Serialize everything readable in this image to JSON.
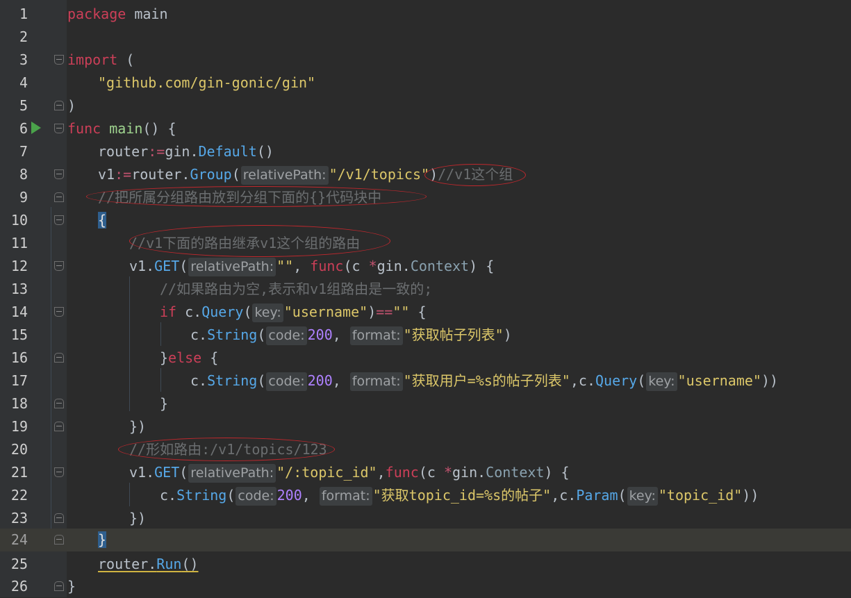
{
  "editor": {
    "language": "go",
    "current_line": 24,
    "colors": {
      "background": "#2b2b2b",
      "gutter": "#313335",
      "keyword": "#cc3f58",
      "function": "#9fd48f",
      "method": "#56a8e8",
      "string": "#dcc769",
      "comment": "#6b6e70",
      "annotation_ellipse": "#c0282d"
    },
    "line_numbers": [
      "1",
      "2",
      "3",
      "4",
      "5",
      "6",
      "7",
      "8",
      "9",
      "10",
      "11",
      "12",
      "13",
      "14",
      "15",
      "16",
      "17",
      "18",
      "19",
      "20",
      "21",
      "22",
      "23",
      "24",
      "25",
      "26"
    ],
    "lines": {
      "l1": {
        "kw": "package",
        "rest": " main"
      },
      "l3": {
        "kw": "import",
        "rest": " ("
      },
      "l4": {
        "str": "\"github.com/gin-gonic/gin\""
      },
      "l5": {
        "rest": ")"
      },
      "l6": {
        "kw": "func",
        "fn": "main",
        "rest": "() {"
      },
      "l7": {
        "a": "router",
        "op": ":=",
        "b": "gin.",
        "m": "Default",
        "c": "()"
      },
      "l8": {
        "a": "v1",
        "op": ":=",
        "b": "router.",
        "m": "Group",
        "p1": "(",
        "hint": "relativePath:",
        "str": "\"/v1/topics\"",
        "p2": ")",
        "cmt": "//v1这个组"
      },
      "l9": {
        "cmt": "//把所属分组路由放到分组下面的{}代码块中"
      },
      "l10": {
        "brace": "{"
      },
      "l11": {
        "cmt": "//v1下面的路由继承v1这个组的路由"
      },
      "l12": {
        "a": "v1.",
        "m": "GET",
        "p1": "(",
        "hint": "relativePath:",
        "str": "\"\"",
        "b": ", ",
        "kw": "func",
        "c": "(c ",
        "op": "*",
        "d": "gin.",
        "typ": "Context",
        "e": ") {"
      },
      "l13": {
        "cmt": "//如果路由为空,表示和v1组路由是一致的;"
      },
      "l14": {
        "kw": "if",
        "a": " c.",
        "m": "Query",
        "p1": "(",
        "hint": "key:",
        "str": "\"username\"",
        "p2": ")",
        "op": "==",
        "str2": "\"\"",
        "b": " {"
      },
      "l15": {
        "a": "c.",
        "m": "String",
        "p1": "(",
        "hint1": "code:",
        "num": "200",
        "b": ", ",
        "hint2": "format:",
        "str": "\"获取帖子列表\"",
        "p2": ")"
      },
      "l16": {
        "a": "}",
        "kw": "else",
        "b": " {"
      },
      "l17": {
        "a": "c.",
        "m": "String",
        "p1": "(",
        "hint1": "code:",
        "num": "200",
        "b": ", ",
        "hint2": "format:",
        "str": "\"获取用户=%s的帖子列表\"",
        "c": ",c.",
        "m2": "Query",
        "p3": "(",
        "hint3": "key:",
        "str2": "\"username\"",
        "p4": "))"
      },
      "l18": {
        "rest": "}"
      },
      "l19": {
        "rest": "})"
      },
      "l20": {
        "cmt": "//形如路由:/v1/topics/123"
      },
      "l21": {
        "a": "v1.",
        "m": "GET",
        "p1": "(",
        "hint": "relativePath:",
        "str": "\"/:topic_id\"",
        "b": ",",
        "kw": "func",
        "c": "(c ",
        "op": "*",
        "d": "gin.",
        "typ": "Context",
        "e": ") {"
      },
      "l22": {
        "a": "c.",
        "m": "String",
        "p1": "(",
        "hint1": "code:",
        "num": "200",
        "b": ", ",
        "hint2": "format:",
        "str": "\"获取topic_id=%s的帖子\"",
        "c": ",c.",
        "m2": "Param",
        "p3": "(",
        "hint3": "key:",
        "str2": "\"topic_id\"",
        "p4": "))"
      },
      "l23": {
        "rest": "})"
      },
      "l24": {
        "brace": "}"
      },
      "l25": {
        "a": "router.",
        "m": "Run",
        "c": "()"
      },
      "l26": {
        "rest": "}"
      }
    }
  }
}
